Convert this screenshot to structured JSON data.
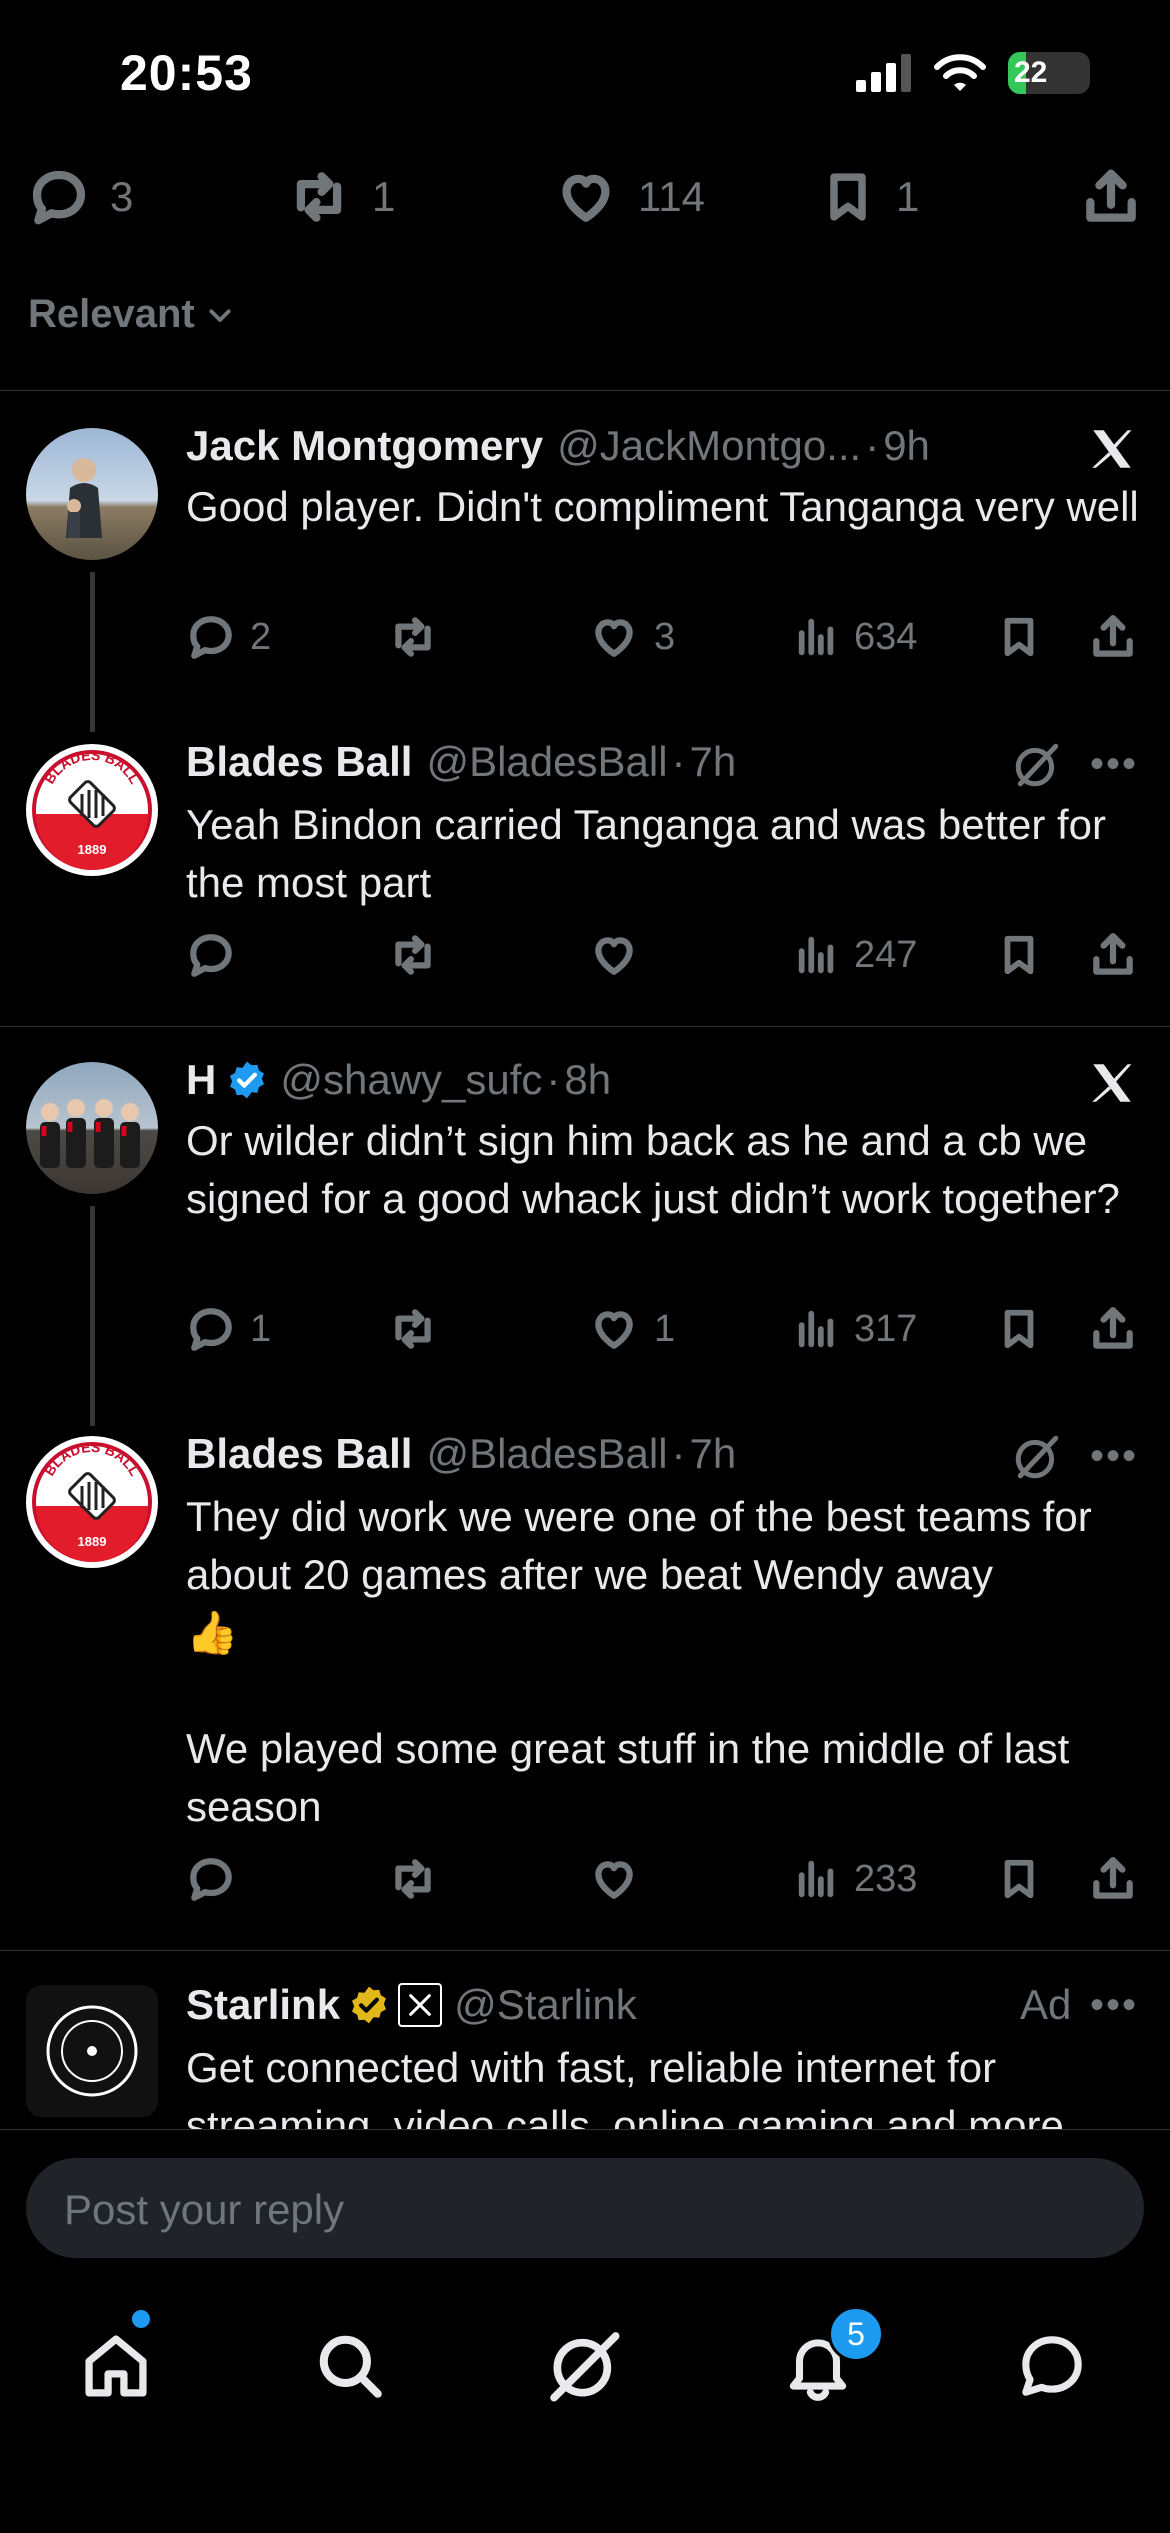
{
  "status_bar": {
    "time": "20:53",
    "battery": "22",
    "battery_level": 0.22
  },
  "post_actions": {
    "replies": "3",
    "reposts": "1",
    "likes": "114",
    "bookmarks": "1"
  },
  "filter": {
    "label": "Relevant"
  },
  "tweets": [
    {
      "name": "Jack Montgomery",
      "handle": "@JackMontgo...",
      "dot": "·",
      "time": "9h",
      "text": "Good player. Didn't compliment Tanganga very well",
      "replies": "2",
      "reposts": "",
      "likes": "3",
      "views": "634"
    },
    {
      "name": "Blades Ball",
      "handle": "@BladesBall",
      "dot": "·",
      "time": "7h",
      "text": "Yeah Bindon carried Tanganga and was better for the most part",
      "replies": "",
      "reposts": "",
      "likes": "",
      "views": "247",
      "logo_text": "BLADES BALL",
      "logo_year": "1889"
    },
    {
      "name": "H",
      "handle": "@shawy_sufc",
      "dot": "·",
      "time": "8h",
      "text": "Or wilder didn’t sign him back as he and a cb we signed for a good whack just didn’t work together?",
      "replies": "1",
      "reposts": "",
      "likes": "1",
      "views": "317"
    },
    {
      "name": "Blades Ball",
      "handle": "@BladesBall",
      "dot": "·",
      "time": "7h",
      "text": "They did work we were one of the best teams for about 20 games after we beat Wendy away\n👍\n\nWe played some great stuff in the middle of last season",
      "replies": "",
      "reposts": "",
      "likes": "",
      "views": "233",
      "logo_text": "BLADES BALL",
      "logo_year": "1889"
    }
  ],
  "ad": {
    "name": "Starlink",
    "handle": "@Starlink",
    "label": "Ad",
    "text": "Get connected with fast, reliable internet for streaming, video calls, online gaming and more"
  },
  "reply_bar": {
    "placeholder": "Post your reply"
  },
  "tab_bar": {
    "notifications_badge": "5"
  },
  "colors": {
    "background": "#000000",
    "accent": "#1d9bf0",
    "muted": "#71767b",
    "verified_gold": "#e2b719"
  }
}
